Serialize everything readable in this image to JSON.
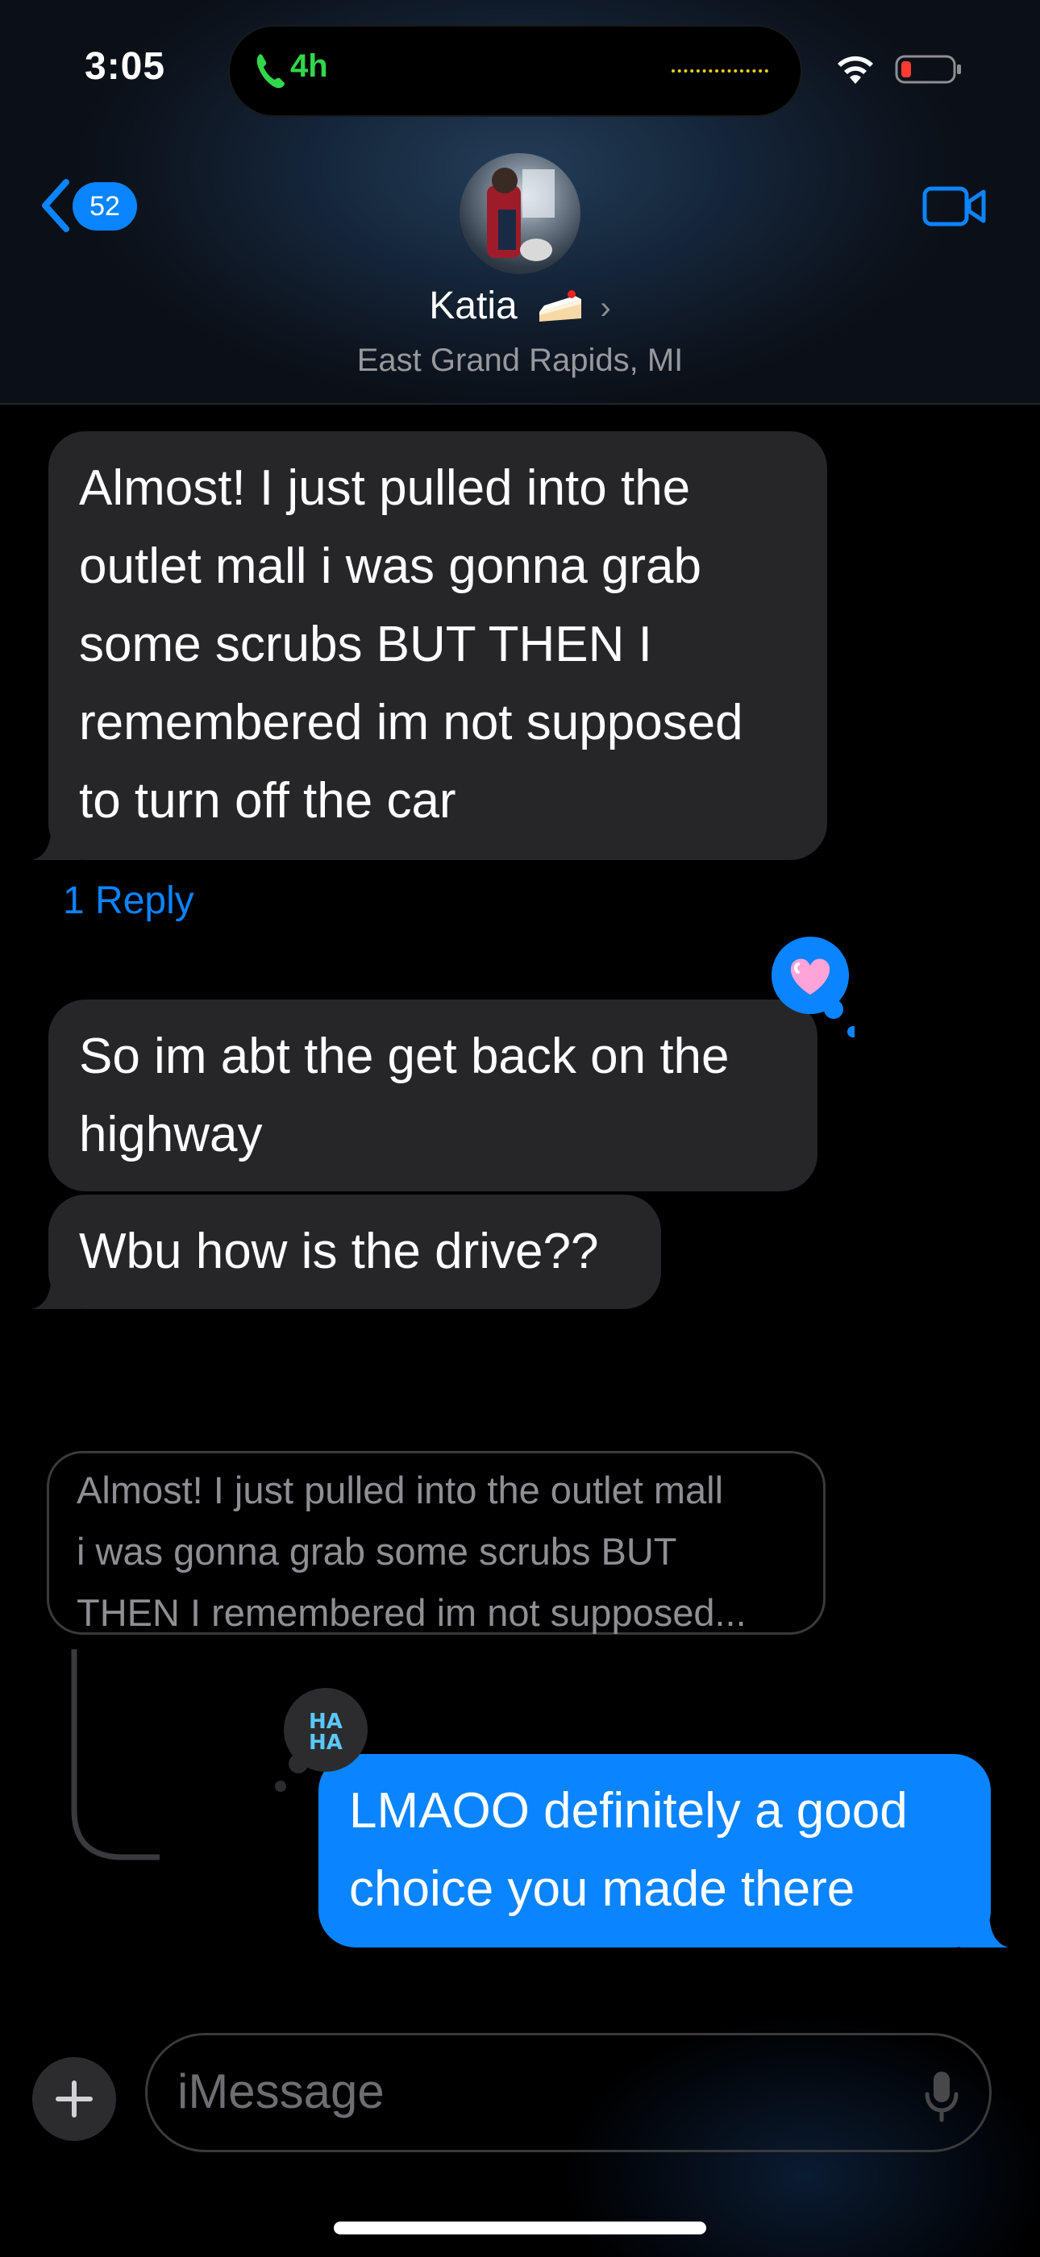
{
  "status_bar": {
    "time": "3:05",
    "call_duration": "4h",
    "icons": [
      "phone-icon",
      "wifi-icon",
      "battery-low-icon"
    ],
    "battery_color": "#ff3b30",
    "call_color": "#32d74b"
  },
  "header": {
    "back_count": "52",
    "contact_name": "Katia",
    "contact_emoji": "cake-icon",
    "location": "East Grand Rapids, MI",
    "accent": "#0a84ff"
  },
  "messages": [
    {
      "from": "them",
      "text": "Almost! I just pulled into the outlet mall i was gonna grab some scrubs BUT THEN I remembered im not supposed to turn off the car",
      "lines": [
        "Almost! I just pulled into the",
        "outlet mall i was gonna grab",
        "some scrubs BUT THEN I",
        "remembered im not supposed",
        "to turn off the car"
      ],
      "replies_label": "1 Reply"
    },
    {
      "from": "them",
      "lines": [
        "So im abt the get back on the",
        "highway"
      ],
      "tapback": "heart-icon"
    },
    {
      "from": "them",
      "lines": [
        "Wbu how is the drive??"
      ]
    },
    {
      "type": "quoted",
      "lines": [
        "Almost! I just pulled into the outlet mall",
        "i was gonna grab some scrubs BUT",
        "THEN I remembered im not supposed..."
      ]
    },
    {
      "from": "me",
      "lines": [
        "LMAOO definitely a good",
        "choice you made there"
      ],
      "tapback": "haha-icon",
      "bubble_color": "#0a84ff"
    }
  ],
  "composer": {
    "placeholder": "iMessage",
    "add_button": "plus-icon",
    "mic": "mic-icon"
  }
}
